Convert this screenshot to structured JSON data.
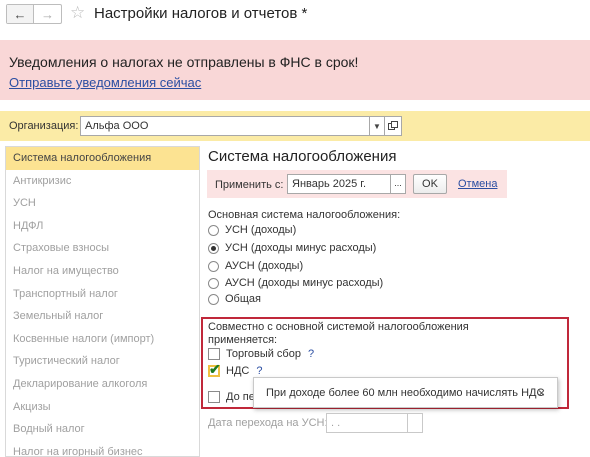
{
  "header": {
    "back_icon": "arrow-left",
    "forward_icon": "arrow-right",
    "star_icon": "star-outline",
    "title": "Настройки налогов и отчетов *"
  },
  "alert": {
    "message": "Уведомления о налогах не отправлены в ФНС в срок!",
    "link": "Отправьте уведомления сейчас",
    "background": "#f9d7d7"
  },
  "organization": {
    "label": "Организация:",
    "value": "Альфа ООО",
    "dropdown_icon": "chevron-down",
    "open_icon": "open-window"
  },
  "sidebar": {
    "items": [
      {
        "label": "Система налогообложения",
        "active": true
      },
      {
        "label": "Антикризис"
      },
      {
        "label": "УСН"
      },
      {
        "label": "НДФЛ"
      },
      {
        "label": "Страховые взносы"
      },
      {
        "label": "Налог на имущество"
      },
      {
        "label": "Транспортный налог"
      },
      {
        "label": "Земельный налог"
      },
      {
        "label": "Косвенные налоги (импорт)"
      },
      {
        "label": "Туристический налог"
      },
      {
        "label": "Декларирование алкоголя"
      },
      {
        "label": "Акцизы"
      },
      {
        "label": "Водный налог"
      },
      {
        "label": "Налог на игорный бизнес"
      }
    ]
  },
  "main": {
    "section_title": "Система налогообложения",
    "apply": {
      "label": "Применить с:",
      "value": "Январь 2025 г.",
      "dots": "...",
      "ok": "OK",
      "cancel": "Отмена"
    },
    "main_system_label": "Основная система налогообложения:",
    "options": [
      {
        "label": "УСН (доходы)",
        "checked": false
      },
      {
        "label": "УСН (доходы минус расходы)",
        "checked": true
      },
      {
        "label": "АУСН (доходы)",
        "checked": false
      },
      {
        "label": "АУСН (доходы минус расходы)",
        "checked": false
      },
      {
        "label": "Общая",
        "checked": false
      }
    ],
    "combined_label": "Совместно с основной системой налогообложения применяется:",
    "checkboxes": {
      "trade_fee": {
        "label": "Торговый сбор",
        "help": "?",
        "checked": false
      },
      "vat": {
        "label": "НДС",
        "help": "?",
        "checked": true
      },
      "transition": {
        "label": "До пер",
        "checked": false
      }
    },
    "tooltip": {
      "text": "При доходе более 60 млн необходимо начислять НДС",
      "close": "×"
    },
    "transition_date": {
      "label": "Дата перехода на УСН:",
      "placeholder": " .  .    "
    }
  },
  "colors": {
    "accent_yellow": "#fbeba6",
    "active_item": "#fce392",
    "highlight_border": "#c0283a",
    "link": "#2b4ea2"
  }
}
